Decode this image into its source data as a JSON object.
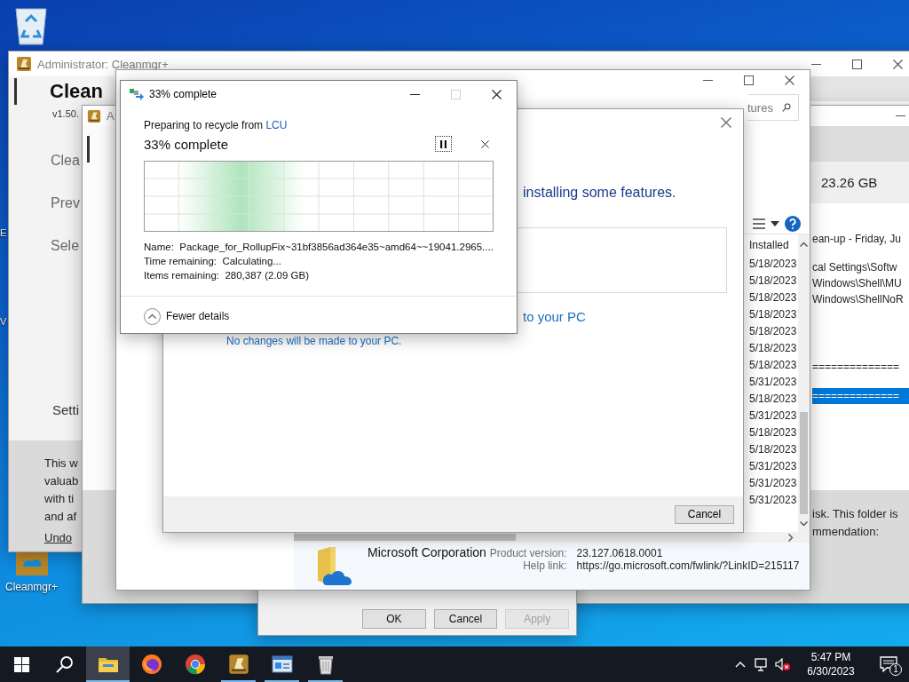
{
  "desktop": {
    "icons": [
      {
        "kind": "bin"
      },
      {
        "kind": "app",
        "label": "Cleanmgr+"
      }
    ],
    "edge_labels": [
      "E",
      "V"
    ]
  },
  "cleanmgr_window": {
    "title": "Administrator: Cleanmgr+",
    "app_name": "Clean",
    "version": "v1.50.",
    "nav": [
      "Clea",
      "Prev",
      "Sele"
    ],
    "settings_item": "Setti",
    "info_lines": [
      "This w",
      "valuab",
      "with ti",
      "and af"
    ],
    "undo_link": "Undo"
  },
  "cleanmgr_window_2": {
    "title": "A",
    "free_space": "23.26 GB",
    "log_groups": [
      [
        "ean-up - Friday, Ju"
      ],
      [
        "cal Settings\\Softw",
        "Windows\\Shell\\MU",
        "Windows\\ShellNoR"
      ]
    ],
    "separators": [
      {
        "text": "==============",
        "selected": false
      },
      {
        "text": "==============",
        "selected": true
      }
    ],
    "notice_lines": [
      "isk. This folder is",
      "mmendation:"
    ]
  },
  "properties_dialog": {
    "buttons": [
      {
        "label": "OK",
        "disabled": false
      },
      {
        "label": "Cancel",
        "disabled": false
      },
      {
        "label": "Apply",
        "disabled": true
      }
    ]
  },
  "programs_window": {
    "search_placeholder": "tures",
    "column_header": "Installed",
    "installed_dates": [
      "5/18/2023",
      "5/18/2023",
      "5/18/2023",
      "5/18/2023",
      "5/18/2023",
      "5/18/2023",
      "5/18/2023",
      "5/31/2023",
      "5/18/2023",
      "5/31/2023",
      "5/18/2023",
      "5/18/2023",
      "5/31/2023",
      "5/31/2023",
      "5/31/2023"
    ],
    "details": {
      "publisher": "Microsoft Corporation",
      "version_label": "Product version:",
      "version": "23.127.0618.0001",
      "help_label": "Help link:",
      "help_link": "https://go.microsoft.com/fwlink/?LinkID=215117"
    }
  },
  "features_dialog": {
    "heading": "installing some features.",
    "link": "to your PC",
    "note": "No changes will be made to your PC.",
    "cancel": "Cancel"
  },
  "progress_dialog": {
    "title": "33% complete",
    "maximize_disabled": true,
    "source_prefix": "Preparing to recycle from",
    "source": "LCU",
    "status": "33% complete",
    "details": [
      {
        "label": "Name:",
        "value": "Package_for_RollupFix~31bf3856ad364e35~amd64~~19041.2965...."
      },
      {
        "label": "Time remaining:",
        "value": "Calculating..."
      },
      {
        "label": "Items remaining:",
        "value": "280,387 (2.09 GB)"
      }
    ],
    "toggle": "Fewer details"
  },
  "taskbar": {
    "apps": [
      {
        "kind": "folder",
        "active": true,
        "running": true
      },
      {
        "kind": "fox",
        "active": false,
        "running": false
      },
      {
        "kind": "wheel",
        "active": false,
        "running": false
      },
      {
        "kind": "broom",
        "active": false,
        "running": true
      },
      {
        "kind": "panel",
        "active": false,
        "running": true
      },
      {
        "kind": "bin",
        "active": false,
        "running": true
      }
    ],
    "time": "5:47 PM",
    "date": "6/30/2023",
    "notification_count": "1"
  }
}
